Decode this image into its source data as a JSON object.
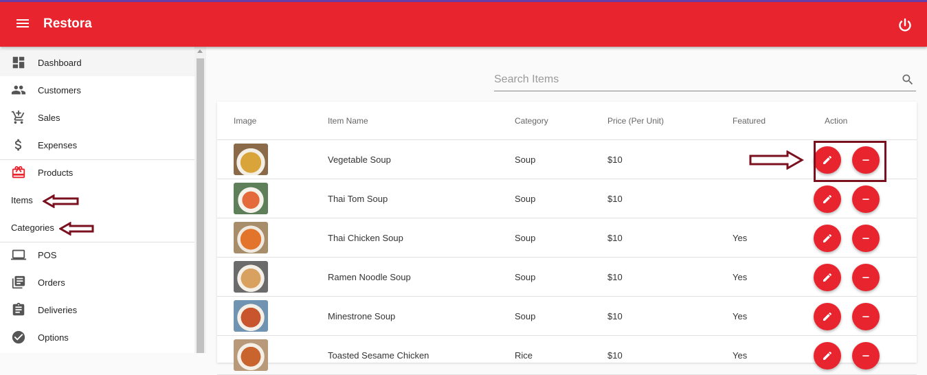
{
  "app": {
    "title": "Restora"
  },
  "header": {
    "menu_icon": "menu-icon",
    "power_icon": "power-icon"
  },
  "sidebar": {
    "items": [
      {
        "label": "Dashboard",
        "icon": "dashboard-icon",
        "active": true
      },
      {
        "label": "Customers",
        "icon": "people-icon"
      },
      {
        "label": "Sales",
        "icon": "add-cart-icon"
      },
      {
        "label": "Expenses",
        "icon": "dollar-icon"
      },
      {
        "label": "Products",
        "icon": "gift-icon",
        "accent": "#e8242e"
      },
      {
        "label": "Items"
      },
      {
        "label": "Categories"
      },
      {
        "label": "POS",
        "icon": "laptop-icon"
      },
      {
        "label": "Orders",
        "icon": "library-icon"
      },
      {
        "label": "Deliveries",
        "icon": "clipboard-icon"
      },
      {
        "label": "Options",
        "icon": "check-circle-icon"
      }
    ]
  },
  "search": {
    "placeholder": "Search Items",
    "value": ""
  },
  "table": {
    "headers": [
      "Image",
      "Item Name",
      "Category",
      "Price (Per Unit)",
      "Featured",
      "Action"
    ],
    "rows": [
      {
        "name": "Vegetable Soup",
        "category": "Soup",
        "price": "$10",
        "featured": ""
      },
      {
        "name": "Thai Tom Soup",
        "category": "Soup",
        "price": "$10",
        "featured": ""
      },
      {
        "name": "Thai Chicken Soup",
        "category": "Soup",
        "price": "$10",
        "featured": "Yes"
      },
      {
        "name": "Ramen Noodle Soup",
        "category": "Soup",
        "price": "$10",
        "featured": "Yes"
      },
      {
        "name": "Minestrone Soup",
        "category": "Soup",
        "price": "$10",
        "featured": "Yes"
      },
      {
        "name": "Toasted Sesame Chicken",
        "category": "Rice",
        "price": "$10",
        "featured": "Yes"
      }
    ]
  },
  "colors": {
    "primary": "#e8242e",
    "annotation": "#7a0f1e",
    "topline": "#6a3fa8"
  }
}
